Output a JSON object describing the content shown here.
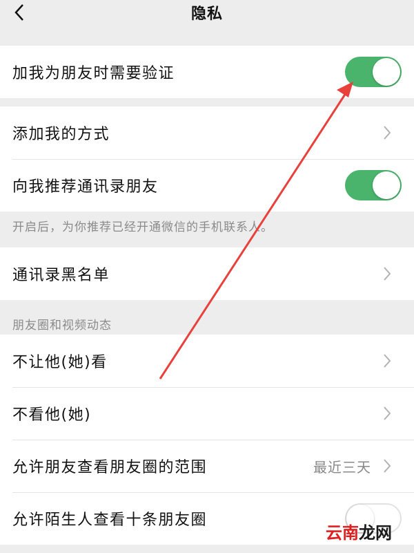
{
  "nav": {
    "title": "隐私"
  },
  "group1": {
    "items": [
      {
        "label": "加我为朋友时需要验证",
        "toggle": "on"
      }
    ]
  },
  "group2": {
    "items": [
      {
        "label": "添加我的方式"
      },
      {
        "label": "向我推荐通讯录朋友",
        "toggle": "on"
      }
    ],
    "note": "开启后，为你推荐已经开通微信的手机联系人。"
  },
  "group3": {
    "items": [
      {
        "label": "通讯录黑名单"
      }
    ]
  },
  "moments": {
    "section_title": "朋友圈和视频动态",
    "items": [
      {
        "label": "不让他(她)看"
      },
      {
        "label": "不看他(她)"
      },
      {
        "label": "允许朋友查看朋友圈的范围",
        "value": "最近三天"
      },
      {
        "label": "允许陌生人查看十条朋友圈",
        "toggle": "off"
      }
    ]
  },
  "annotation": {
    "arrow_color": "#e8413c"
  },
  "watermark": {
    "part1": "云南",
    "part2": "龙网"
  },
  "colors": {
    "toggle_on": "#4ab46c",
    "background": "#ededed"
  }
}
